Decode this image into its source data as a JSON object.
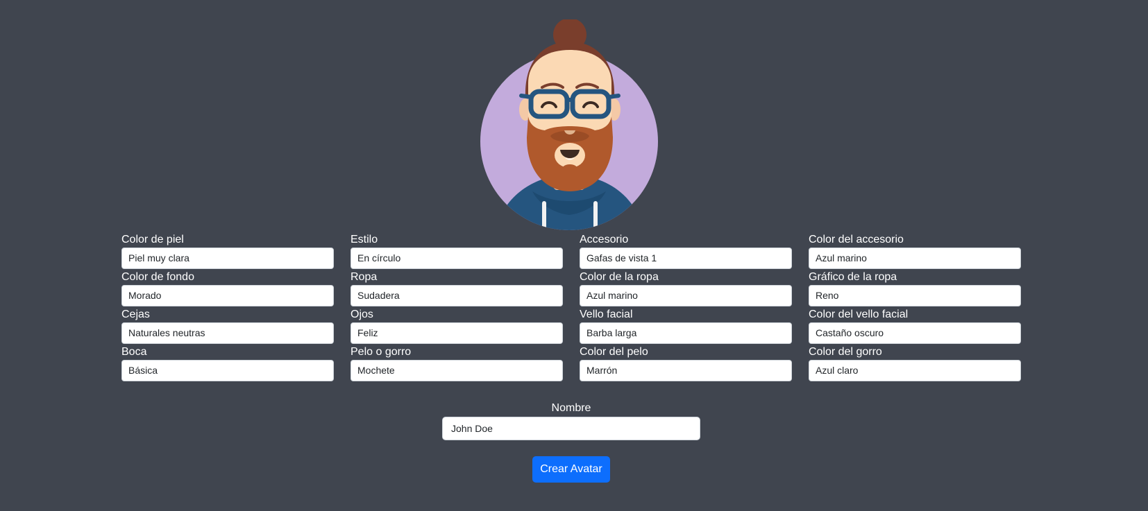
{
  "avatar": {
    "description_icon": "avatar-illustration",
    "background_color": "#c3abdc"
  },
  "fields": [
    {
      "label": "Color de piel",
      "value": "Piel muy clara"
    },
    {
      "label": "Estilo",
      "value": "En círculo"
    },
    {
      "label": "Accesorio",
      "value": "Gafas de vista 1"
    },
    {
      "label": "Color del accesorio",
      "value": "Azul marino"
    },
    {
      "label": "Color de fondo",
      "value": "Morado"
    },
    {
      "label": "Ropa",
      "value": "Sudadera"
    },
    {
      "label": "Color de la ropa",
      "value": "Azul marino"
    },
    {
      "label": "Gráfico de la ropa",
      "value": "Reno"
    },
    {
      "label": "Cejas",
      "value": "Naturales neutras"
    },
    {
      "label": "Ojos",
      "value": "Feliz"
    },
    {
      "label": "Vello facial",
      "value": "Barba larga"
    },
    {
      "label": "Color del vello facial",
      "value": "Castaño oscuro"
    },
    {
      "label": "Boca",
      "value": "Básica"
    },
    {
      "label": "Pelo o gorro",
      "value": "Mochete"
    },
    {
      "label": "Color del pelo",
      "value": "Marrón"
    },
    {
      "label": "Color del gorro",
      "value": "Azul claro"
    }
  ],
  "name": {
    "label": "Nombre",
    "value": "John Doe"
  },
  "submit": {
    "label": "Crear Avatar"
  },
  "colors": {
    "page_background": "#40454f",
    "button_primary": "#0d6efd",
    "text": "#ffffff"
  }
}
